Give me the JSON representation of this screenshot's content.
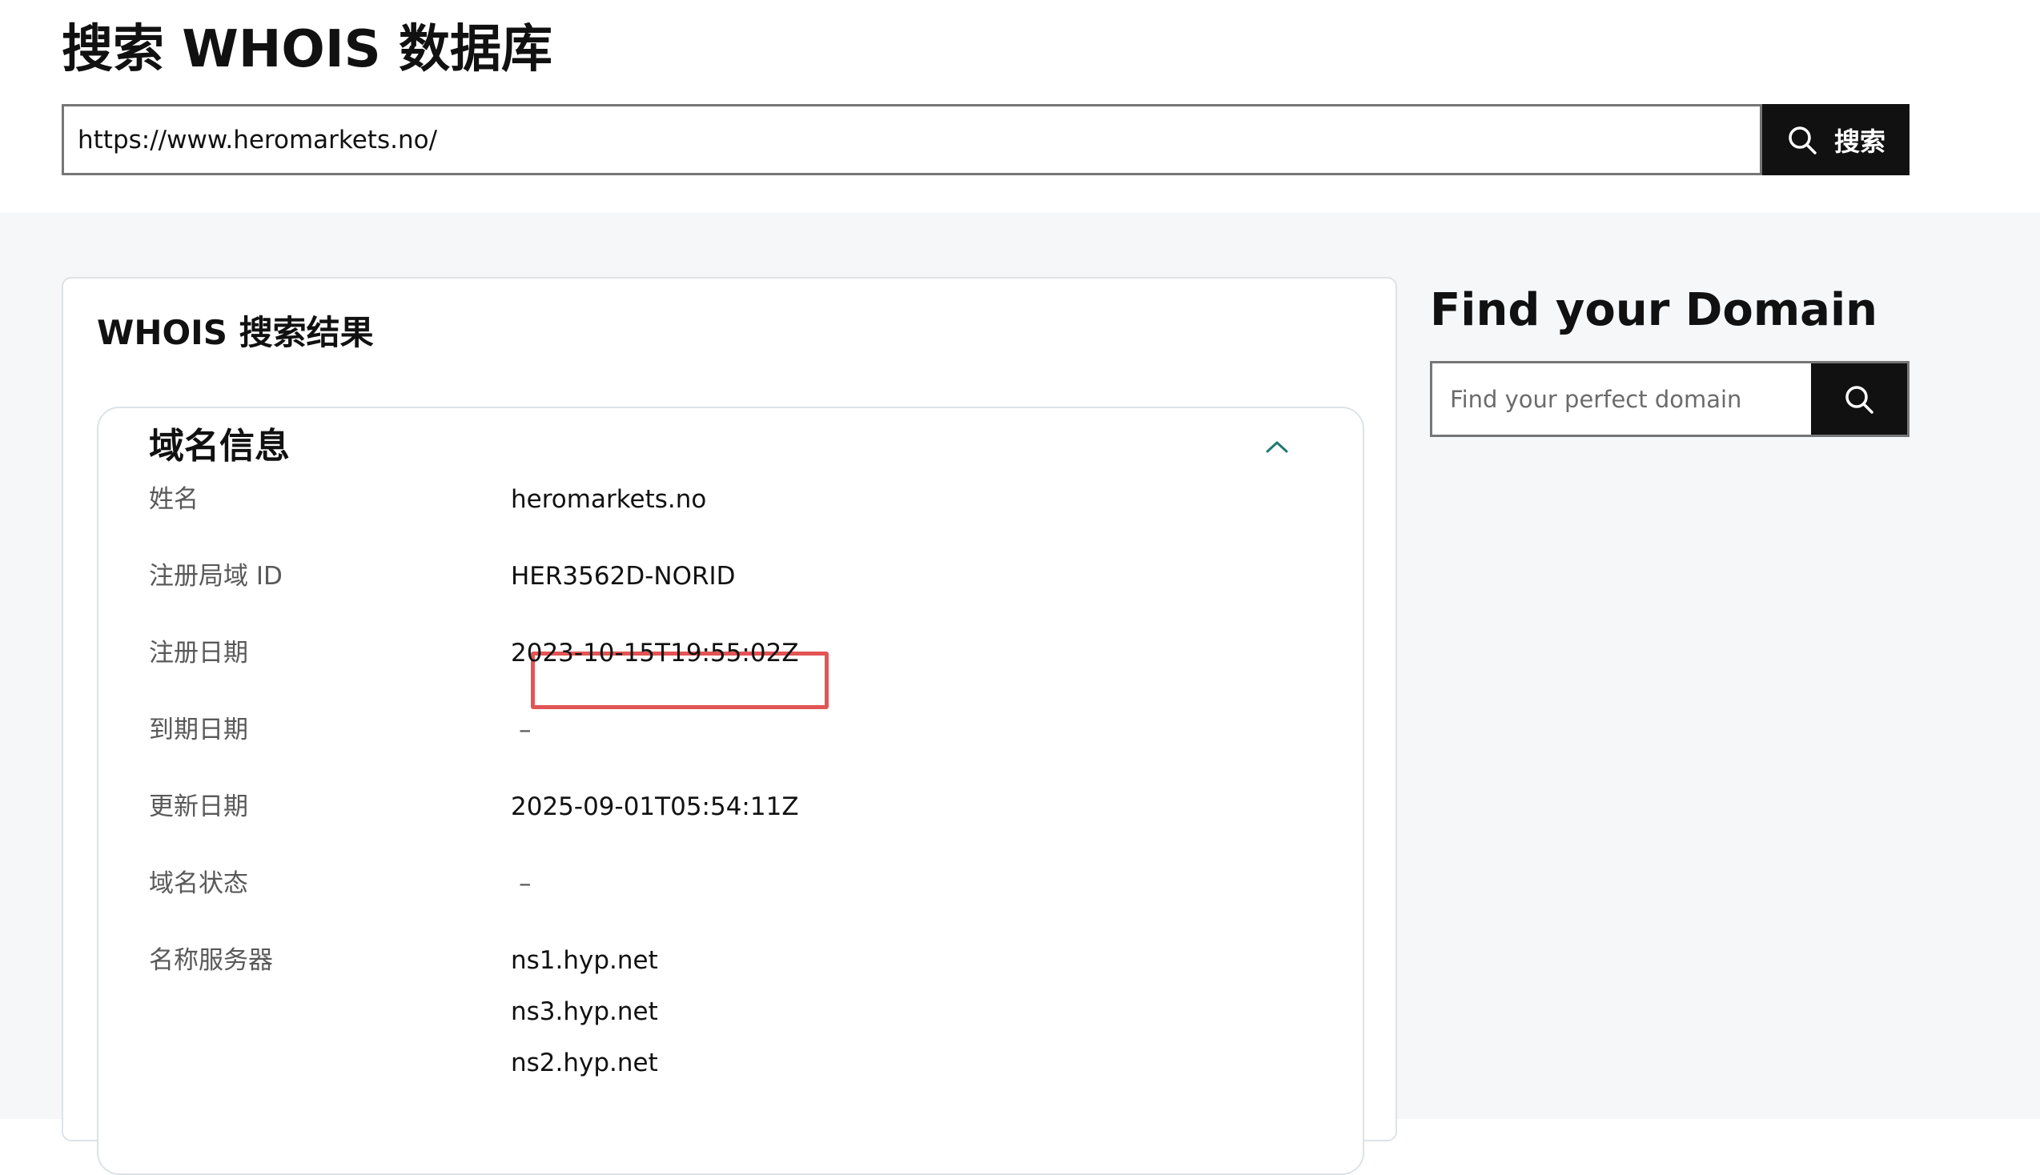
{
  "header": {
    "title": "搜索 WHOIS 数据库",
    "search_value": "https://www.heromarkets.no/",
    "search_button_label": "搜索"
  },
  "results": {
    "title": "WHOIS 搜索结果",
    "panel": {
      "title": "域名信息",
      "expanded": true,
      "rows": [
        {
          "label": "姓名",
          "values": [
            "heromarkets.no"
          ]
        },
        {
          "label": "注册局域 ID",
          "values": [
            "HER3562D-NORID"
          ]
        },
        {
          "label": "注册日期",
          "values": [
            "2023-10-15T19:55:02Z"
          ],
          "highlighted": true
        },
        {
          "label": "到期日期",
          "values": [
            "–"
          ]
        },
        {
          "label": "更新日期",
          "values": [
            "2025-09-01T05:54:11Z"
          ]
        },
        {
          "label": "域名状态",
          "values": [
            "–"
          ]
        },
        {
          "label": "名称服务器",
          "values": [
            "ns1.hyp.net",
            "ns3.hyp.net",
            "ns2.hyp.net"
          ]
        }
      ]
    }
  },
  "sidebar": {
    "title": "Find your Domain",
    "search_placeholder": "Find your perfect domain"
  },
  "colors": {
    "button_bg": "#111111",
    "page_bg": "#f5f7f8",
    "highlight": "#e35454",
    "chevron": "#1f7a6e",
    "label_text": "#595959"
  },
  "icons": {
    "search_button_icon": "search-icon",
    "collapse_icon": "chevron-up-icon",
    "sidebar_search_icon": "search-icon"
  }
}
